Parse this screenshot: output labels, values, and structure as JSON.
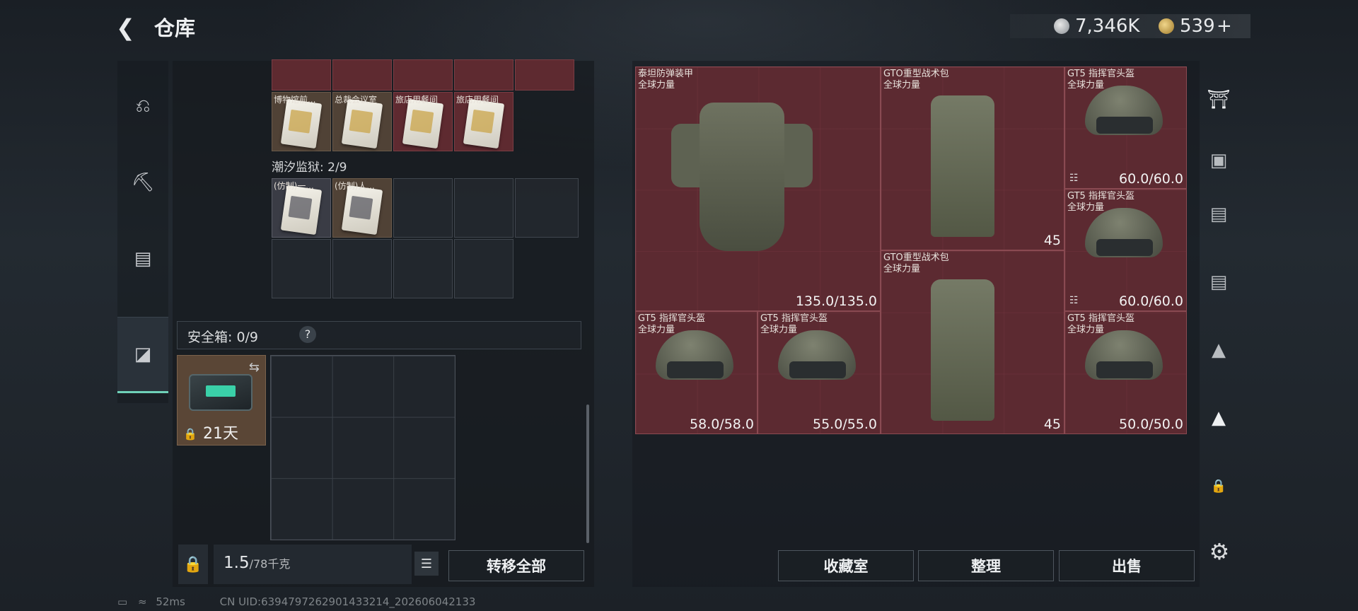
{
  "header": {
    "back_icon": "back-arrow-icon",
    "title": "仓库",
    "silver": "7,346K",
    "gold": "539",
    "plus": "+"
  },
  "nav": {
    "items": [
      {
        "name": "weapon"
      },
      {
        "name": "armor"
      },
      {
        "name": "backpack"
      },
      {
        "name": "safebox"
      }
    ]
  },
  "left_items": {
    "top_labels": [
      "博物馆前...",
      "总裁会议室",
      "旅店用餐间",
      "旅店用餐间"
    ],
    "section_label": "潮汐监狱: 2/9",
    "mid_labels": [
      "(仿制)一...",
      "(仿制)人..."
    ]
  },
  "safebox": {
    "label": "安全箱: 0/9",
    "help": "?",
    "days": "21天"
  },
  "weight": {
    "value": "1.5",
    "unit": "/78千克"
  },
  "buttons": {
    "transfer_all": "转移全部",
    "collection": "收藏室",
    "organize": "整理",
    "sell": "出售"
  },
  "items": [
    {
      "name": "泰坦防弹装甲",
      "sub": "全球力量",
      "dur": "135.0/135.0"
    },
    {
      "name": "GTO重型战术包",
      "sub": "全球力量",
      "weight": "45"
    },
    {
      "name": "GT5 指挥官头盔",
      "sub": "全球力量",
      "dur": "60.0/60.0"
    },
    {
      "name": "GT5 指挥官头盔",
      "sub": "全球力量",
      "dur": "60.0/60.0"
    },
    {
      "name": "GTO重型战术包",
      "sub": "全球力量",
      "weight": "45"
    },
    {
      "name": "GT5 指挥官头盔",
      "sub": "全球力量",
      "dur": "58.0/58.0"
    },
    {
      "name": "GT5 指挥官头盔",
      "sub": "全球力量",
      "dur": "55.0/55.0"
    },
    {
      "name": "GT5 指挥官头盔",
      "sub": "全球力量",
      "dur": "50.0/50.0"
    }
  ],
  "status": {
    "ping": "52ms",
    "uid": "CN UID:6394797262901433214_202606042133"
  }
}
